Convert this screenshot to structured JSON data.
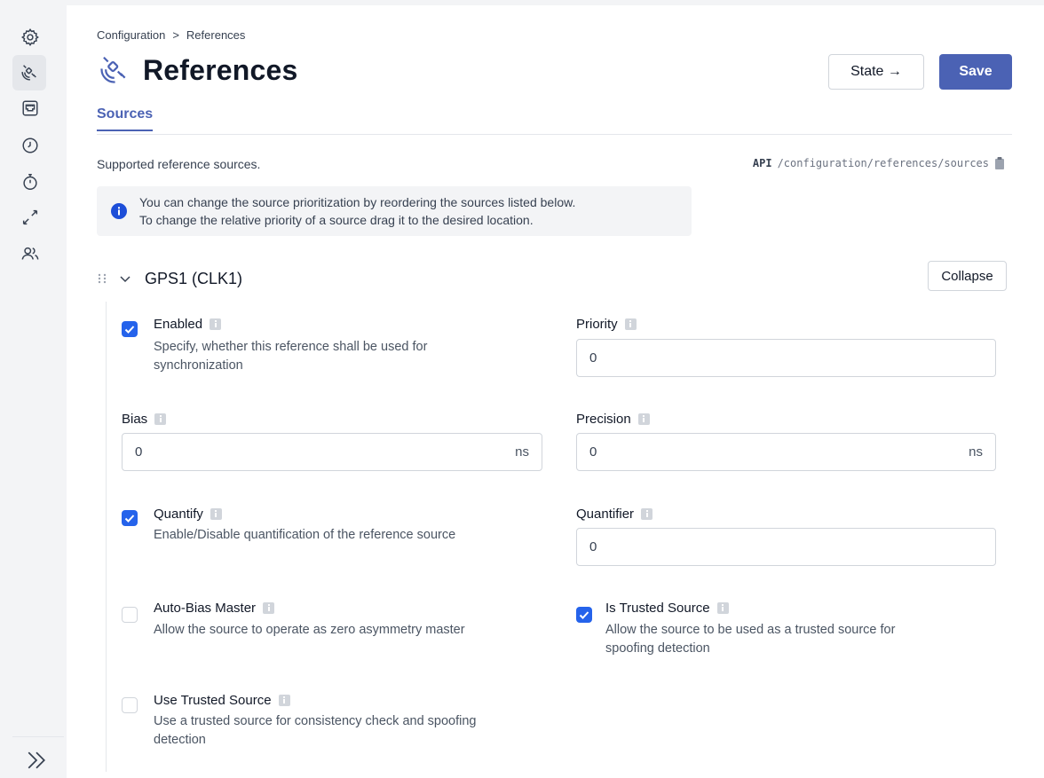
{
  "breadcrumb": {
    "root": "Configuration",
    "separator": ">",
    "current": "References"
  },
  "page": {
    "title": "References"
  },
  "actions": {
    "state_label": "State →",
    "save_label": "Save"
  },
  "tabs": [
    {
      "label": "Sources",
      "active": true
    }
  ],
  "sources": {
    "description": "Supported reference sources.",
    "api_tag": "API",
    "api_path": "/configuration/references/sources",
    "info_line1": "You can change the source prioritization by reordering the sources listed below.",
    "info_line2": "To change the relative priority of a source drag it to the desired location."
  },
  "source": {
    "title": "GPS1 (CLK1)",
    "collapse_label": "Collapse",
    "enabled": {
      "label": "Enabled",
      "help1": "Specify, whether this reference shall be used for",
      "help2": "synchronization",
      "checked": true
    },
    "priority": {
      "label": "Priority",
      "value": "0"
    },
    "bias": {
      "label": "Bias",
      "value": "0",
      "unit": "ns"
    },
    "precision": {
      "label": "Precision",
      "value": "0",
      "unit": "ns"
    },
    "quantify": {
      "label": "Quantify",
      "help1": "Enable/Disable quantification of the reference source",
      "checked": true
    },
    "quantifier": {
      "label": "Quantifier",
      "value": "0"
    },
    "auto_bias_master": {
      "label": "Auto-Bias Master",
      "help1": "Allow the source to operate as zero asymmetry master",
      "checked": false
    },
    "is_trusted_source": {
      "label": "Is Trusted Source",
      "help1": "Allow the source to be used as a trusted source for",
      "help2": "spoofing detection",
      "checked": true
    },
    "use_trusted_source": {
      "label": "Use Trusted Source",
      "help1": "Use a trusted source for consistency check and spoofing",
      "help2": "detection",
      "checked": false
    }
  },
  "colors": {
    "accent": "#4b62b4",
    "checkbox": "#2563eb",
    "info_icon": "#1d4ed8"
  },
  "icons": {
    "sidebar": [
      "gear-icon",
      "satellite-icon",
      "ethernet-port-icon",
      "clock-icon",
      "stopwatch-icon",
      "expand-arrows-icon",
      "users-icon"
    ],
    "sidebar_expand": "double-chevron-right-icon"
  }
}
